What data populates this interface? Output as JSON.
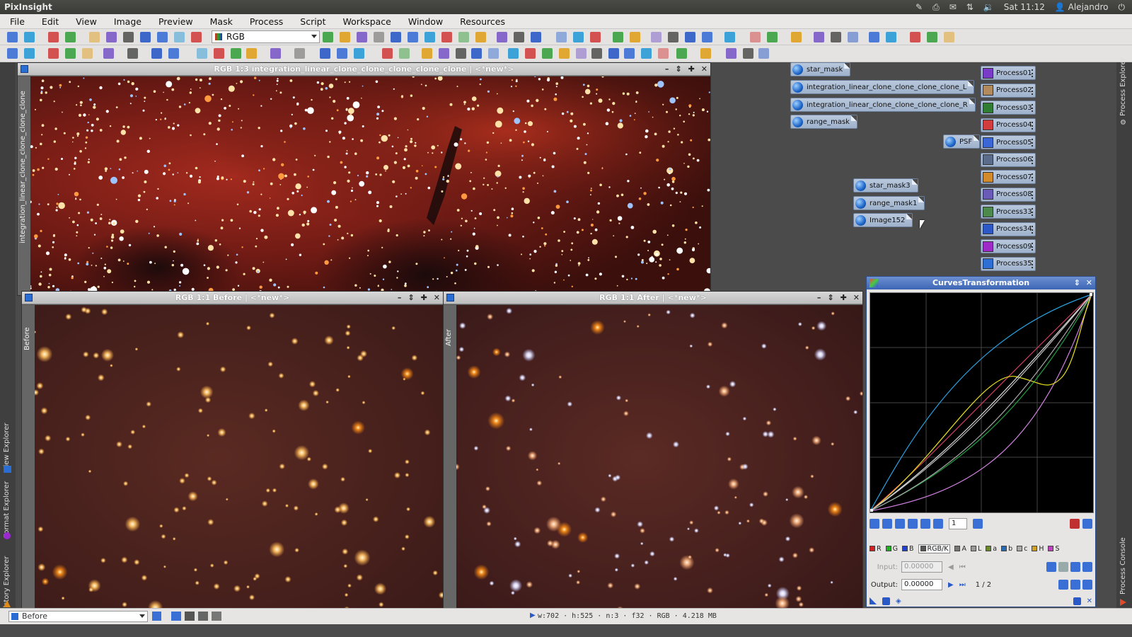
{
  "system": {
    "app_title": "PixInsight",
    "clock": "Sat 11:12",
    "user": "Alejandro"
  },
  "menu": [
    "File",
    "Edit",
    "View",
    "Image",
    "Preview",
    "Mask",
    "Process",
    "Script",
    "Workspace",
    "Window",
    "Resources"
  ],
  "toolbar": {
    "channel_select": "RGB"
  },
  "windows": {
    "main": {
      "title": "RGB 1:3 integration_linear_clone_clone_clone_clone_clone | <*new*>",
      "side_label": "integration_linear_clone_clone_clone_clone"
    },
    "before": {
      "title": "RGB 1:1 Before | <*new*>",
      "side_label": "Before"
    },
    "after": {
      "title": "RGB 1:1 After | <*new*>",
      "side_label": "After"
    }
  },
  "image_icons": [
    {
      "name": "star_mask"
    },
    {
      "name": "integration_linear_clone_clone_clone_clone_L"
    },
    {
      "name": "integration_linear_clone_clone_clone_clone_R"
    },
    {
      "name": "range_mask"
    },
    {
      "name": "PSF"
    },
    {
      "name": "star_mask3"
    },
    {
      "name": "range_mask1"
    },
    {
      "name": "Image152"
    }
  ],
  "process_icons": [
    {
      "name": "Process01",
      "color": "#7a3cc8"
    },
    {
      "name": "Process02",
      "color": "#b28a5c"
    },
    {
      "name": "Process03",
      "color": "#2e7d32"
    },
    {
      "name": "Process04",
      "color": "#d23c3c"
    },
    {
      "name": "Process05",
      "color": "#3b66d6"
    },
    {
      "name": "Process06",
      "color": "#5b6b8a"
    },
    {
      "name": "Process07",
      "color": "#d38a2a"
    },
    {
      "name": "Process08",
      "color": "#6b5bb8"
    },
    {
      "name": "Process33",
      "color": "#4c8a4c"
    },
    {
      "name": "Process34",
      "color": "#2d58c8"
    },
    {
      "name": "Process09",
      "color": "#a02ac8"
    },
    {
      "name": "Process35",
      "color": "#2e6fd6"
    }
  ],
  "side_tabs": {
    "left": [
      "View Explorer",
      "Format Explorer",
      "History Explorer"
    ],
    "right": [
      "Process Explorer",
      "Process Console"
    ]
  },
  "curves": {
    "title": "CurvesTransformation",
    "zoom": "1",
    "channels": [
      {
        "label": "R",
        "color": "#d32020"
      },
      {
        "label": "G",
        "color": "#22b022"
      },
      {
        "label": "B",
        "color": "#2040d0"
      },
      {
        "label": "RGB/K",
        "color": "#555555",
        "active": true
      },
      {
        "label": "A",
        "color": "#777777"
      },
      {
        "label": "L",
        "color": "#999999"
      },
      {
        "label": "a",
        "color": "#6a8a2a"
      },
      {
        "label": "b",
        "color": "#2a6ab0"
      },
      {
        "label": "c",
        "color": "#aaaaaa"
      },
      {
        "label": "H",
        "color": "#d0a020"
      },
      {
        "label": "S",
        "color": "#c040c0"
      }
    ],
    "input_label": "Input:",
    "input_value": "0.00000",
    "output_label": "Output:",
    "output_value": "0.00000",
    "point_index": "1 / 2"
  },
  "status": {
    "view": "Before",
    "info": "w:702 · h:525 · n:3 · f32 · RGB · 4.218 MB"
  }
}
